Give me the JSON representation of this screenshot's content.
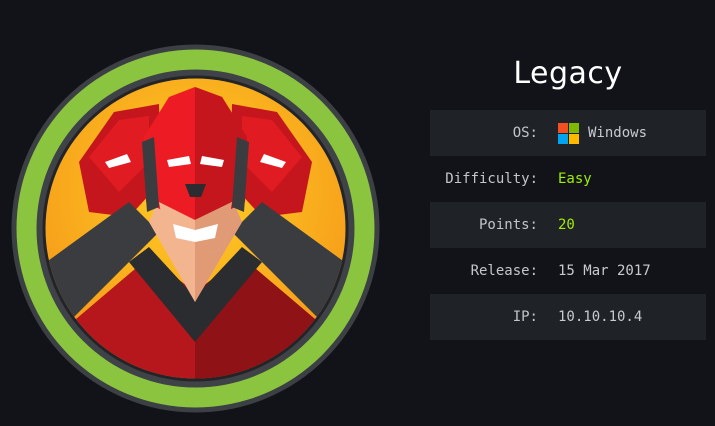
{
  "machine": {
    "name": "Legacy",
    "avatar": "red-three-headed-hacker-avatar",
    "details": [
      {
        "label": "OS:",
        "value": "Windows",
        "icon": "windows-icon",
        "style": "normal"
      },
      {
        "label": "Difficulty:",
        "value": "Easy",
        "style": "green"
      },
      {
        "label": "Points:",
        "value": "20",
        "style": "green"
      },
      {
        "label": "Release:",
        "value": "15 Mar 2017",
        "style": "normal"
      },
      {
        "label": "IP:",
        "value": "10.10.10.4",
        "style": "normal"
      }
    ]
  },
  "colors": {
    "background": "#111318",
    "ring": "#8bc53f",
    "easy_accent": "#9fef00",
    "row_shade": "#1f2226"
  }
}
